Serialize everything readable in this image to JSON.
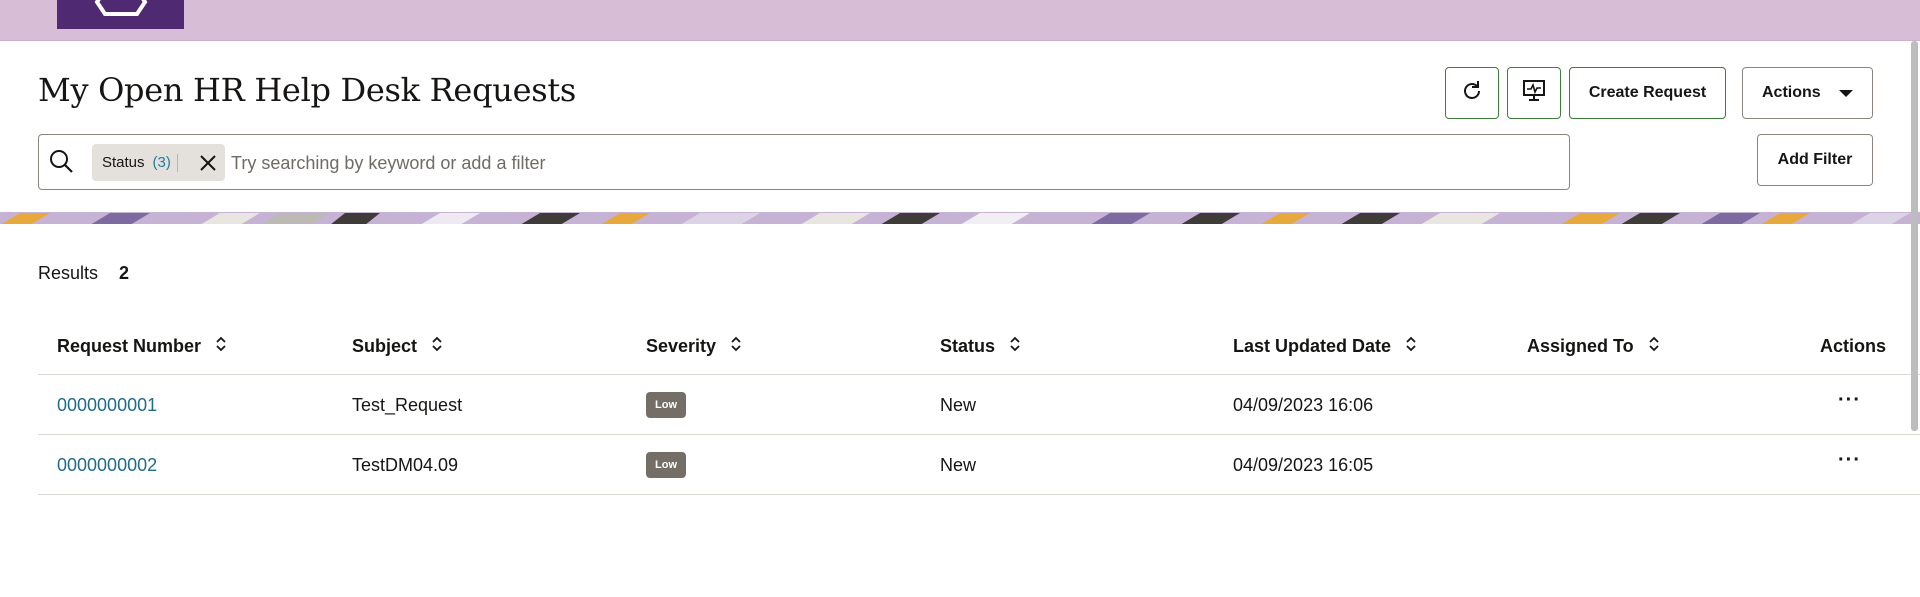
{
  "header": {
    "page_title": "My Open HR Help Desk Requests",
    "create_request_label": "Create Request",
    "actions_label": "Actions"
  },
  "search": {
    "placeholder": "Try searching by keyword or add a filter",
    "chip_label": "Status",
    "chip_count": "(3)",
    "add_filter_label": "Add Filter"
  },
  "results": {
    "label": "Results",
    "count": "2"
  },
  "table": {
    "columns": [
      "Request Number",
      "Subject",
      "Severity",
      "Status",
      "Last Updated Date",
      "Assigned To",
      "Actions"
    ],
    "rows": [
      {
        "request_number": "0000000001",
        "subject": "Test_Request",
        "severity": "Low",
        "status": "New",
        "last_updated": "04/09/2023 16:06",
        "assigned_to": "",
        "actions": "···"
      },
      {
        "request_number": "0000000002",
        "subject": "TestDM04.09",
        "severity": "Low",
        "status": "New",
        "last_updated": "04/09/2023 16:05",
        "assigned_to": "",
        "actions": "···"
      }
    ]
  },
  "icons": {
    "logo": "logo-icon",
    "refresh": "refresh-icon",
    "presentation": "presentation-monitor-icon",
    "search": "search-icon",
    "close": "close-icon",
    "sort": "sort-icon",
    "caret": "caret-down-icon"
  },
  "colors": {
    "topbar": "#d8bdd6",
    "logo": "#4f2a73",
    "primary_border": "#3f7d3a",
    "link": "#1f6b8a",
    "badge": "#746e67"
  }
}
